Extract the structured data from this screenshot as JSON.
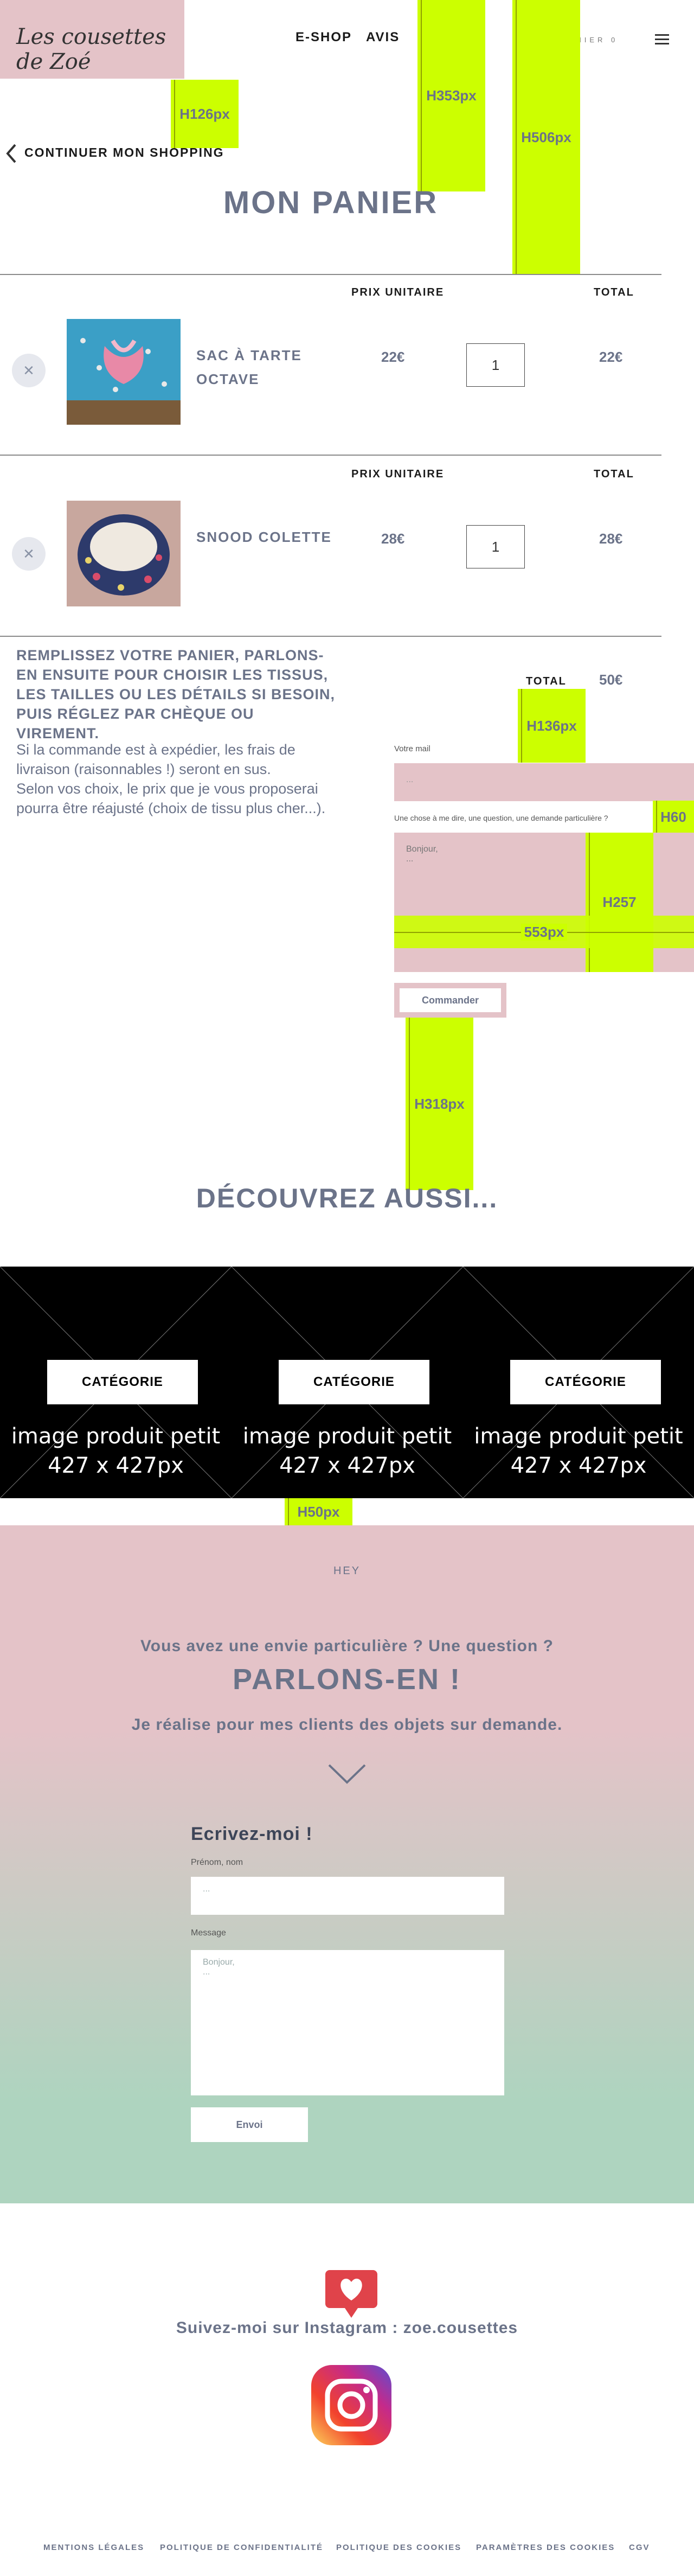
{
  "header": {
    "logo_text": "Les cousettes de Zoé",
    "nav": [
      "E-SHOP",
      "AVIS"
    ],
    "cart_link": "PANIER 0"
  },
  "markers": {
    "m126": "H126px",
    "m353": "H353px",
    "m506": "H506px",
    "m136": "H136px",
    "m60": "H60",
    "m257": "H257",
    "m553": "553px",
    "m318": "H318px",
    "m50": "H50px"
  },
  "continue_shopping": "CONTINUER MON SHOPPING",
  "page_title": "MON PANIER",
  "cart": {
    "col_unit": "PRIX UNITAIRE",
    "col_total": "TOTAL",
    "items": [
      {
        "name_line1": "SAC À TARTE",
        "name_line2": "OCTAVE",
        "unit_price": "22€",
        "qty": "1",
        "total": "22€",
        "thumb_color": "#4fa3c9"
      },
      {
        "name_line1": "SNOOD COLETTE",
        "name_line2": "",
        "unit_price": "28€",
        "qty": "1",
        "total": "28€",
        "thumb_color": "#caa6a8"
      }
    ]
  },
  "info": {
    "heading": "REMPLISSEZ VOTRE PANIER, PARLONS-EN ENSUITE POUR CHOISIR LES TISSUS, LES TAILLES OU LES DÉTAILS SI BESOIN, PUIS RÉGLEZ PAR CHÈQUE OU VIREMENT.",
    "p1": "Si la commande est à expédier, les frais de livraison (raisonnables !) seront en sus.",
    "p2": "Selon vos choix, le prix que je vous proposerai pourra être réajusté (choix de tissu plus cher...)."
  },
  "order": {
    "total_label": "TOTAL",
    "total_value": "50€",
    "mail_label": "Votre mail",
    "mail_placeholder": "...",
    "message_label": "Une chose à me dire, une question, une demande particulière ?",
    "message_placeholder": "Bonjour,\n...",
    "submit": "Commander"
  },
  "discover": {
    "title": "DÉCOUVREZ AUSSI...",
    "tiles": [
      {
        "button": "CATÉGORIE",
        "text": "image produit petit 427 x 427px"
      },
      {
        "button": "CATÉGORIE",
        "text": "image produit petit 427 x 427px"
      },
      {
        "button": "CATÉGORIE",
        "text": "image produit petit 427 x 427px"
      }
    ]
  },
  "contact": {
    "kicker": "HEY",
    "question": "Vous avez une envie particulière ? Une question ?",
    "title": "PARLONS-EN !",
    "subtitle": "Je réalise pour mes clients des objets sur demande.",
    "form_title": "Ecrivez-moi !",
    "name_label": "Prénom, nom",
    "name_placeholder": "...",
    "msg_label": "Message",
    "msg_placeholder": "Bonjour,\n...",
    "send": "Envoi"
  },
  "instagram": {
    "label": "Suivez-moi sur Instagram : zoe.cousettes"
  },
  "footer": {
    "links": [
      "MENTIONS LÉGALES",
      "POLITIQUE DE CONFIDENTIALITÉ",
      "POLITIQUE DES COOKIES",
      "PARAMÈTRES DES COOKIES",
      "CGV"
    ]
  },
  "colors": {
    "pink": "#e4c3c8",
    "mint": "#aed4bf",
    "marker": "#ccff00",
    "text": "#6b7389",
    "heart": "#e0434a"
  }
}
